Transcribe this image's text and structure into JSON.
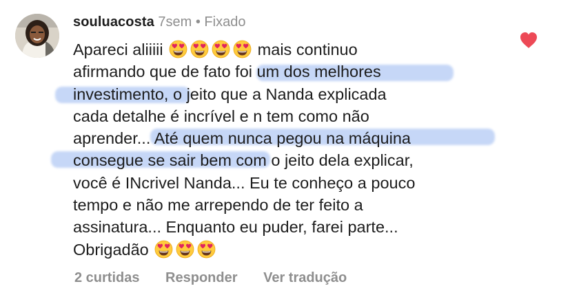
{
  "comment": {
    "username": "souluacosta",
    "time": "7sem",
    "separator": "•",
    "pinned_label": "Fixado",
    "lines": [
      "Apareci aliiiii",
      "mais continuo",
      "afirmando que de fato foi um dos melhores",
      "investimento, o jeito que a Nanda explicada",
      "cada detalhe é incrível e n tem como não",
      "aprender... Até quem nunca pegou na máquina",
      "consegue se sair bem com o jeito dela explicar,",
      "você é INcrivel Nanda... Eu te conheço a pouco",
      "tempo e não me arrependo de ter feito a",
      "assinatura... Enquanto eu puder, farei parte...",
      "Obrigadão"
    ],
    "emoji_name": "heart-eyes-emoji",
    "like_icon": "heart-icon",
    "like_color": "#ed4956",
    "highlight_color": "#78a0ec"
  },
  "actions": {
    "likes": "2 curtidas",
    "reply": "Responder",
    "translate": "Ver tradução"
  }
}
